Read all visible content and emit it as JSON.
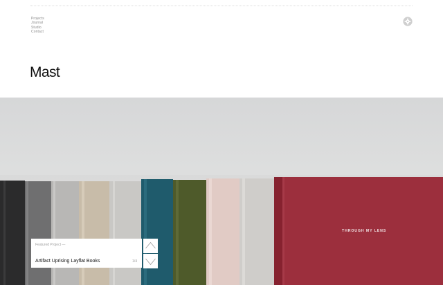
{
  "nav": {
    "items": [
      "Projects",
      "Journal",
      "Studio",
      "Contact"
    ]
  },
  "brand": {
    "name": "Mast"
  },
  "hero": {
    "cover_title": "THROUGH MY LENS",
    "colors": {
      "wall": "#dcdcdc",
      "red_book": "#9c2f3d"
    }
  },
  "featured": {
    "kicker": "Featured Project —",
    "title": "Artifact Uprising Layflat Books",
    "counter": "1/4"
  },
  "icons": {
    "settings": "gear-icon",
    "prev": "chevron-up-icon",
    "next": "chevron-down-icon"
  }
}
